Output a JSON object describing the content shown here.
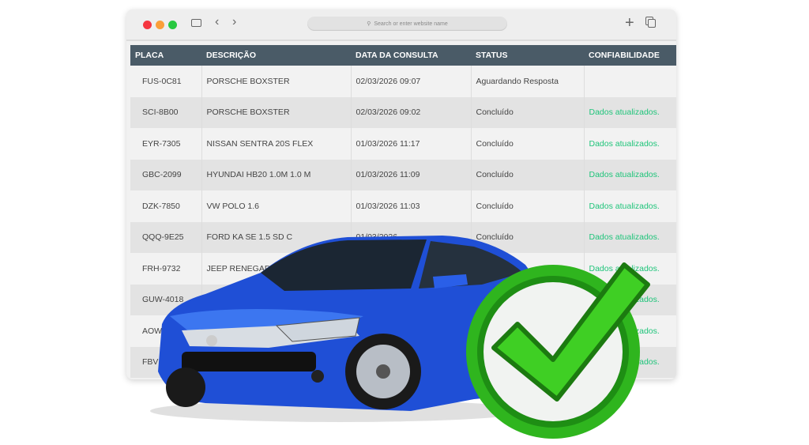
{
  "browser": {
    "url_placeholder": "Search or enter website name",
    "icons": [
      "sidebar-icon",
      "back-icon",
      "forward-icon",
      "search-icon",
      "plus-icon",
      "tabs-icon"
    ],
    "traffic_lights": [
      "#f5353f",
      "#fa9f39",
      "#28c840"
    ]
  },
  "table": {
    "headers": [
      "PLACA",
      "DESCRIÇÃO",
      "DATA DA CONSULTA",
      "STATUS",
      "CONFIABILIDADE"
    ],
    "rows": [
      [
        "FUS-0C81",
        "PORSCHE BOXSTER",
        "02/03/2026 09:07",
        "Aguardando Resposta",
        ""
      ],
      [
        "SCI-8B00",
        "PORSCHE BOXSTER",
        "02/03/2026 09:02",
        "Concluído",
        "Dados atualizados."
      ],
      [
        "EYR-7305",
        "NISSAN SENTRA 20S FLEX",
        "01/03/2026 11:17",
        "Concluído",
        "Dados atualizados."
      ],
      [
        "GBC-2099",
        "HYUNDAI HB20 1.0M 1.0 M",
        "01/03/2026 11:09",
        "Concluído",
        "Dados atualizados."
      ],
      [
        "DZK-7850",
        "VW POLO 1.6",
        "01/03/2026 11:03",
        "Concluído",
        "Dados atualizados."
      ],
      [
        "QQQ-9E25",
        "FORD KA SE 1.5 SD C",
        "01/03/2026",
        "Concluído",
        "Dados atualizados."
      ],
      [
        "FRH-9732",
        "JEEP RENEGADE L",
        "",
        "",
        "Dados atualizados."
      ],
      [
        "GUW-4018",
        "",
        "",
        "",
        "Dados atualizados."
      ],
      [
        "AOW-",
        "",
        "",
        "",
        "Dados atualizados."
      ],
      [
        "FBV",
        "",
        "",
        "",
        "Dados atualizados."
      ]
    ]
  },
  "colors": {
    "header": "#4a5b67",
    "ok_text": "#1fc47a",
    "car": "#1f4fd6",
    "check": "#2fb51e"
  }
}
